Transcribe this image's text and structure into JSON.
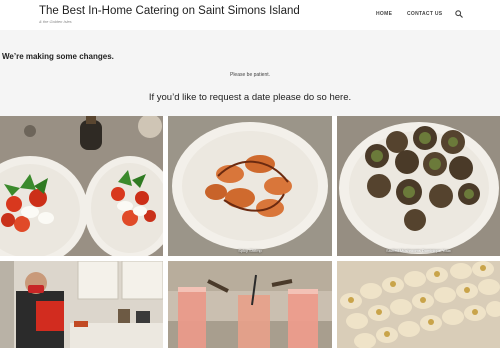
{
  "site": {
    "title": "The Best In-Home Catering on Saint Simons Island",
    "tagline": "& the Golden Isles"
  },
  "nav": {
    "items": [
      {
        "label": "HOME"
      },
      {
        "label": "CONTACT US"
      }
    ],
    "search_icon": "search-icon"
  },
  "main": {
    "heading": "We’re making some changes.",
    "patience_text": "Please be patient.",
    "request_text": "If you’d like to request a date please do so here."
  },
  "gallery": [
    {
      "caption": ""
    },
    {
      "caption": "Spicy Shrimp"
    },
    {
      "caption": "Stuffed Mushrooms Dominique Youx"
    },
    {
      "caption": ""
    },
    {
      "caption": ""
    },
    {
      "caption": ""
    }
  ],
  "colors": {
    "header_bg": "#ffffff",
    "content_bg": "#f5f5f5",
    "text": "#222222"
  }
}
